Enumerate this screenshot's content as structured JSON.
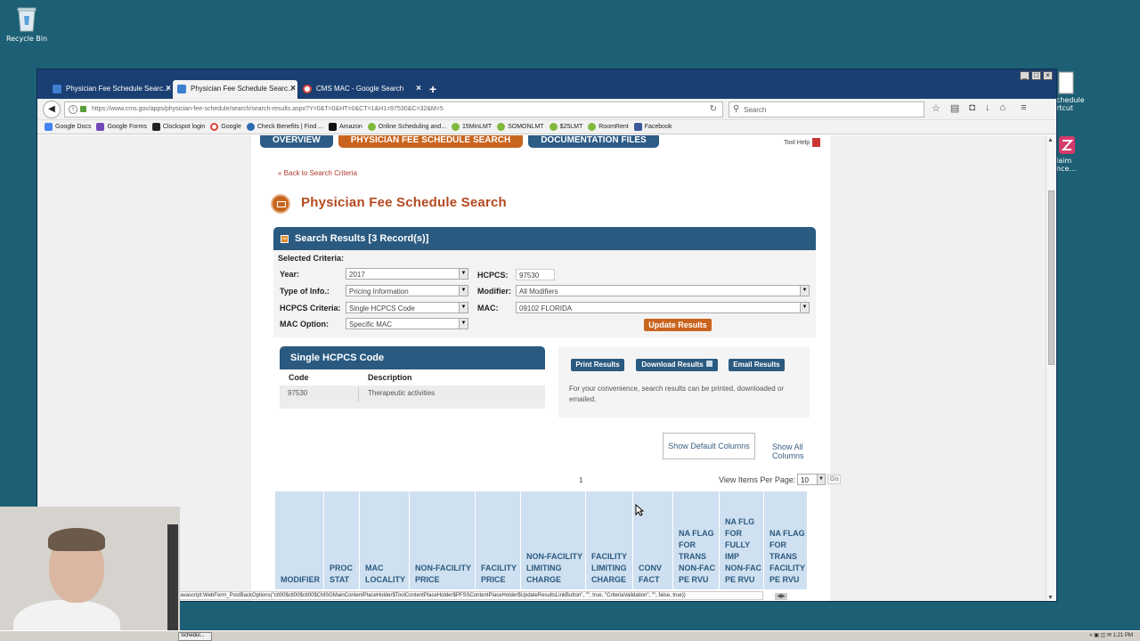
{
  "desktop": {
    "recycle_bin": "Recycle Bin",
    "right_icon_1": "chedule\nrtcut",
    "right_icon_2": "laim\nnce..."
  },
  "browser": {
    "tabs": [
      {
        "label": "Physician Fee Schedule Searc...",
        "active": false
      },
      {
        "label": "Physician Fee Schedule Searc...",
        "active": true
      },
      {
        "label": "CMS MAC - Google Search",
        "active": false
      }
    ],
    "url": "https://www.cms.gov/apps/physician-fee-schedule/search/search-results.aspx?Y=0&T=0&HT=0&CT=1&H1=97530&C=32&M=5",
    "search_placeholder": "Search",
    "bookmarks": [
      "Google Docs",
      "Google Forms",
      "Clockspot login",
      "Google",
      "Check Benefits | Find ...",
      "Amazon",
      "Online Scheduling and...",
      "15MinLMT",
      "SOMONLMT",
      "$25LMT",
      "RoomRent",
      "Facebook"
    ],
    "status_text": "javascript:WebForm_PostBackOptions(\"ctl00$ctl00$ctl00$CMSGMainContentPlaceHolder$ToolContentPlaceHolder$PFSSContentPlaceHolder$UpdateResultsLinkButton\", \"\", true, \"CriteriaValidation\", \"\", false, true))"
  },
  "page": {
    "nav": [
      "OVERVIEW",
      "PHYSICIAN FEE SCHEDULE SEARCH",
      "DOCUMENTATION FILES"
    ],
    "tool_help": "Tool Help",
    "back_link": "« Back to Search Criteria",
    "title": "Physician Fee Schedule Search",
    "results_header": "Search Results [3 Record(s)]",
    "selected_criteria": "Selected Criteria:",
    "criteria": {
      "year_label": "Year:",
      "year_value": "2017",
      "type_label": "Type of Info.:",
      "type_value": "Pricing Information",
      "hcpcs_criteria_label": "HCPCS Criteria:",
      "hcpcs_criteria_value": "Single HCPCS Code",
      "mac_option_label": "MAC Option:",
      "mac_option_value": "Specific MAC",
      "hcpcs_label": "HCPCS:",
      "hcpcs_value": "97530",
      "modifier_label": "Modifier:",
      "modifier_value": "All Modifiers",
      "mac_label": "MAC:",
      "mac_value": "09102 FLORIDA"
    },
    "update_button": "Update Results",
    "hcpcs_box": {
      "title": "Single HCPCS Code",
      "col_code": "Code",
      "col_desc": "Description",
      "row_code": "97530",
      "row_desc": "Therapeutic activities"
    },
    "actions": {
      "print": "Print Results",
      "download": "Download Results",
      "email": "Email Results",
      "note": "For your convenience, search results can be printed, downloaded or emailed."
    },
    "show_default": "Show Default Columns",
    "show_all": "Show All Columns",
    "page_number": "1",
    "view_items_label": "View Items Per Page:",
    "view_items_value": "10",
    "go": "Go",
    "columns": [
      "MODIFIER",
      "PROC\nSTAT",
      "MAC\nLOCALITY",
      "NON-FACILITY\nPRICE",
      "FACILITY\nPRICE",
      "NON-FACILITY\nLIMITING\nCHARGE",
      "FACILITY\nLIMITING\nCHARGE",
      "CONV\nFACT",
      "NA FLAG\nFOR\nTRANS\nNON-FAC\nPE RVU",
      "NA FLG\nFOR\nFULLY\nIMP\nNON-FAC\nPE RVU",
      "NA FLAG\nFOR\nTRANS\nFACILITY\nPE RVU"
    ]
  },
  "taskbar": {
    "task_label": "Schedul...",
    "clock": "1:21 PM"
  }
}
